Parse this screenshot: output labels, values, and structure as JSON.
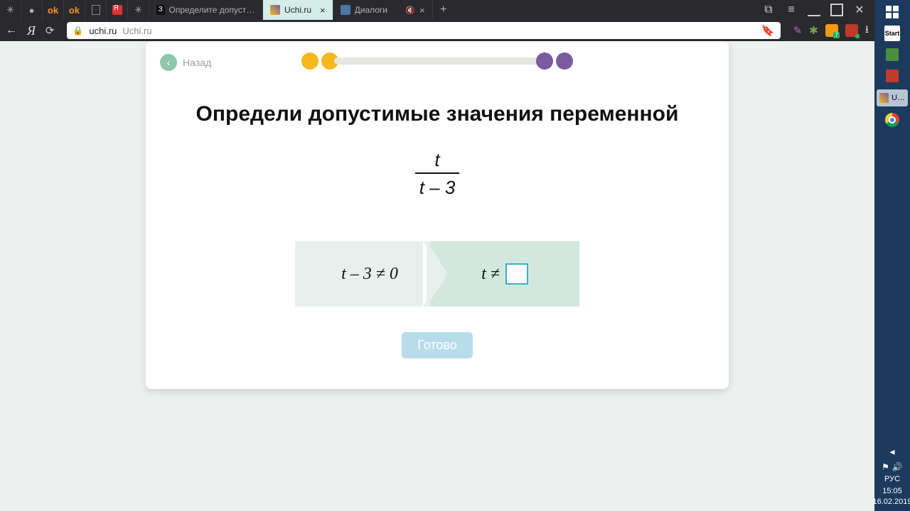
{
  "browser": {
    "tabs": {
      "t3_title": "Определите допустимые з",
      "t3_badge": "З",
      "active_title": "Uchi.ru",
      "t5_title": "Диалоги"
    },
    "address": {
      "domain": "uchi.ru",
      "path": "Uchi.ru"
    }
  },
  "page": {
    "back_label": "Назад",
    "heading": "Определи допустимые значения переменной",
    "fraction_numerator": "t",
    "fraction_denominator": "t – 3",
    "step_a": "t – 3 ≠ 0",
    "step_b_prefix": "t ≠",
    "answer_value": "",
    "done_label": "Готово"
  },
  "system": {
    "taskbar_label": "U…",
    "lang": "РУС",
    "time": "15:05",
    "date": "16.02.2019"
  }
}
